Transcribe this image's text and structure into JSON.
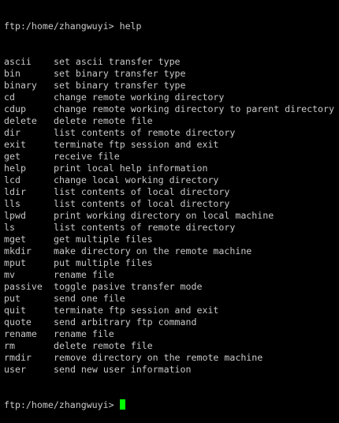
{
  "prompt": "ftp:/home/zhangwuyi>",
  "command": "help",
  "colors": {
    "background": "#000000",
    "text": "#c8c8c8",
    "cursor": "#00ff00"
  },
  "help_entries": [
    {
      "cmd": "ascii",
      "desc": "set ascii transfer type"
    },
    {
      "cmd": "bin",
      "desc": "set binary transfer type"
    },
    {
      "cmd": "binary",
      "desc": "set binary transfer type"
    },
    {
      "cmd": "cd",
      "desc": "change remote working directory"
    },
    {
      "cmd": "cdup",
      "desc": "change remote working directory to parent directory"
    },
    {
      "cmd": "delete",
      "desc": "delete remote file"
    },
    {
      "cmd": "dir",
      "desc": "list contents of remote directory"
    },
    {
      "cmd": "exit",
      "desc": "terminate ftp session and exit"
    },
    {
      "cmd": "get",
      "desc": "receive file"
    },
    {
      "cmd": "help",
      "desc": "print local help information"
    },
    {
      "cmd": "lcd",
      "desc": "change local working directory"
    },
    {
      "cmd": "ldir",
      "desc": "list contents of local directory"
    },
    {
      "cmd": "lls",
      "desc": "list contents of local directory"
    },
    {
      "cmd": "lpwd",
      "desc": "print working directory on local machine"
    },
    {
      "cmd": "ls",
      "desc": "list contents of remote directory"
    },
    {
      "cmd": "mget",
      "desc": "get multiple files"
    },
    {
      "cmd": "mkdir",
      "desc": "make directory on the remote machine"
    },
    {
      "cmd": "mput",
      "desc": "put multiple files"
    },
    {
      "cmd": "mv",
      "desc": "rename file"
    },
    {
      "cmd": "passive",
      "desc": "toggle pasive transfer mode"
    },
    {
      "cmd": "put",
      "desc": "send one file"
    },
    {
      "cmd": "quit",
      "desc": "terminate ftp session and exit"
    },
    {
      "cmd": "quote",
      "desc": "send arbitrary ftp command"
    },
    {
      "cmd": "rename",
      "desc": "rename file"
    },
    {
      "cmd": "rm",
      "desc": "delete remote file"
    },
    {
      "cmd": "rmdir",
      "desc": "remove directory on the remote machine"
    },
    {
      "cmd": "user",
      "desc": "send new user information"
    }
  ]
}
